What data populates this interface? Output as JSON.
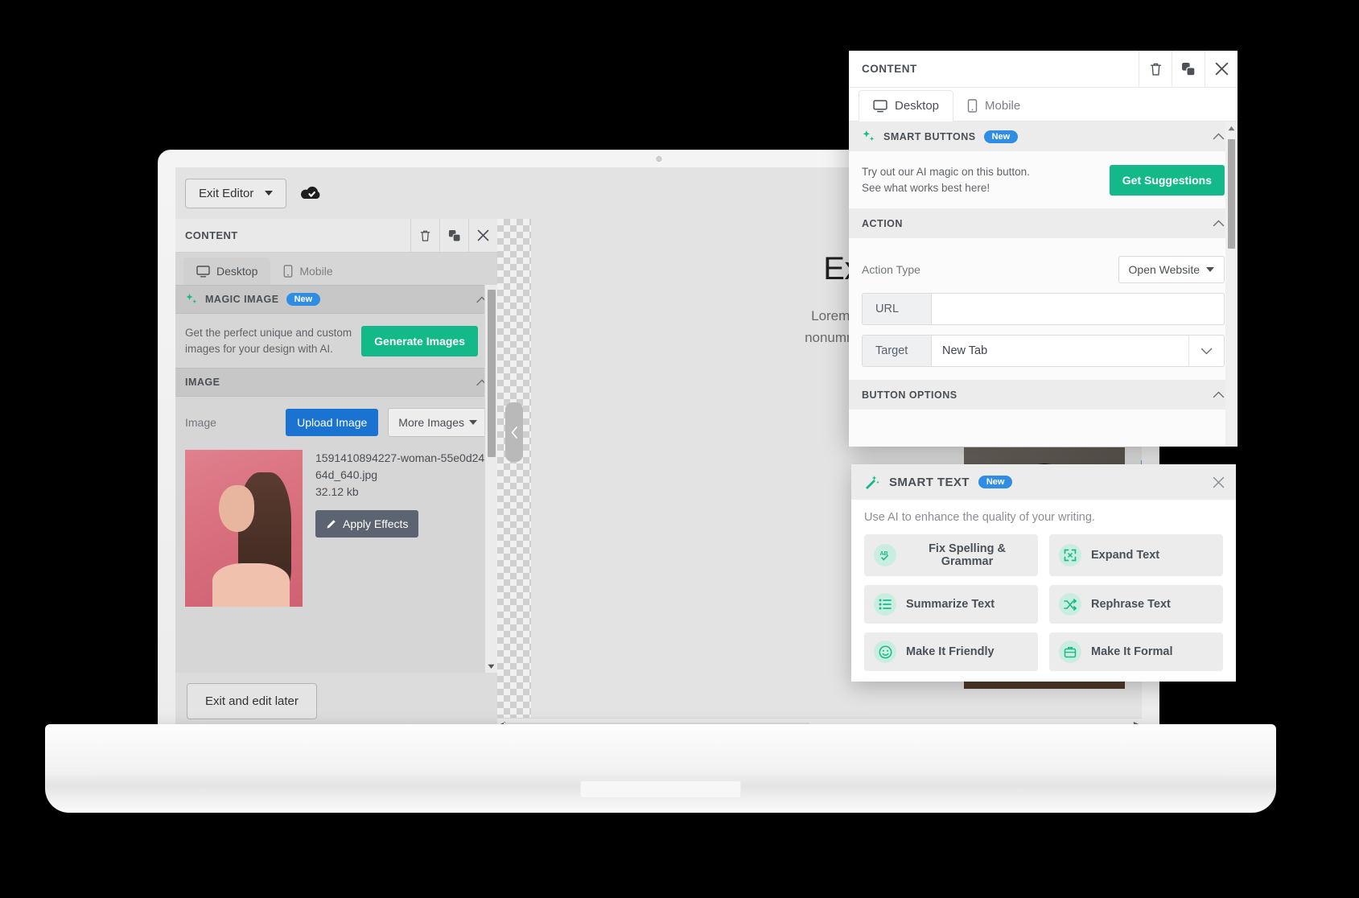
{
  "editor": {
    "topbar": {
      "exit_editor_label": "Exit Editor",
      "cloud_icon": "cloud-save-icon"
    },
    "left_panel": {
      "title": "CONTENT",
      "actions": [
        {
          "name": "delete-icon",
          "glyph": "trash"
        },
        {
          "name": "duplicate-icon",
          "glyph": "copy"
        },
        {
          "name": "close-icon",
          "glyph": "x"
        }
      ],
      "tabs": [
        {
          "label": "Desktop",
          "icon": "desktop-icon",
          "active": true
        },
        {
          "label": "Mobile",
          "icon": "mobile-icon",
          "active": false
        }
      ],
      "magic_image": {
        "title": "MAGIC IMAGE",
        "badge": "New",
        "hint_line1": "Get the perfect unique and custom",
        "hint_line2": "images for your design with AI.",
        "button_label": "Generate Images"
      },
      "image_section": {
        "title": "IMAGE",
        "label": "Image",
        "upload_label": "Upload Image",
        "more_images_label": "More Images",
        "file_name": "1591410894227-woman-55e0d2464d_640.jpg",
        "file_size": "32.12 kb",
        "apply_effects_label": "Apply Effects"
      },
      "footer_button": "Exit and edit later"
    },
    "canvas": {
      "heading": "Experi",
      "body_line1": "Lorem ipsum dolor",
      "body_line2": "nonummy nibh euisn"
    }
  },
  "content_popup": {
    "title": "CONTENT",
    "actions": [
      {
        "name": "delete-icon",
        "glyph": "trash"
      },
      {
        "name": "duplicate-icon",
        "glyph": "copy"
      },
      {
        "name": "close-icon",
        "glyph": "x"
      }
    ],
    "tabs": [
      {
        "label": "Desktop",
        "icon": "desktop-icon",
        "active": true
      },
      {
        "label": "Mobile",
        "icon": "mobile-icon",
        "active": false
      }
    ],
    "smart_buttons": {
      "title": "SMART BUTTONS",
      "badge": "New",
      "hint_line1": "Try out our AI magic on this button.",
      "hint_line2": "See what works best here!",
      "button_label": "Get Suggestions"
    },
    "action": {
      "title": "ACTION",
      "action_type_label": "Action Type",
      "action_type_value": "Open Website",
      "url_label": "URL",
      "url_value": "",
      "url_placeholder": "",
      "target_label": "Target",
      "target_value": "New Tab"
    },
    "button_options": {
      "title": "BUTTON OPTIONS"
    }
  },
  "smart_text_popup": {
    "title": "SMART TEXT",
    "badge": "New",
    "subtitle": "Use AI to enhance the quality of your writing.",
    "actions": [
      {
        "label": "Fix Spelling & Grammar",
        "icon": "spellcheck-icon"
      },
      {
        "label": "Expand Text",
        "icon": "expand-icon"
      },
      {
        "label": "Summarize Text",
        "icon": "list-icon"
      },
      {
        "label": "Rephrase Text",
        "icon": "shuffle-icon"
      },
      {
        "label": "Make It Friendly",
        "icon": "smiley-icon"
      },
      {
        "label": "Make It Formal",
        "icon": "briefcase-icon"
      }
    ]
  },
  "colors": {
    "accent_green": "#14b98a",
    "accent_blue": "#1a73d1",
    "badge_blue": "#2f8de4",
    "slate": "#5b6470"
  }
}
